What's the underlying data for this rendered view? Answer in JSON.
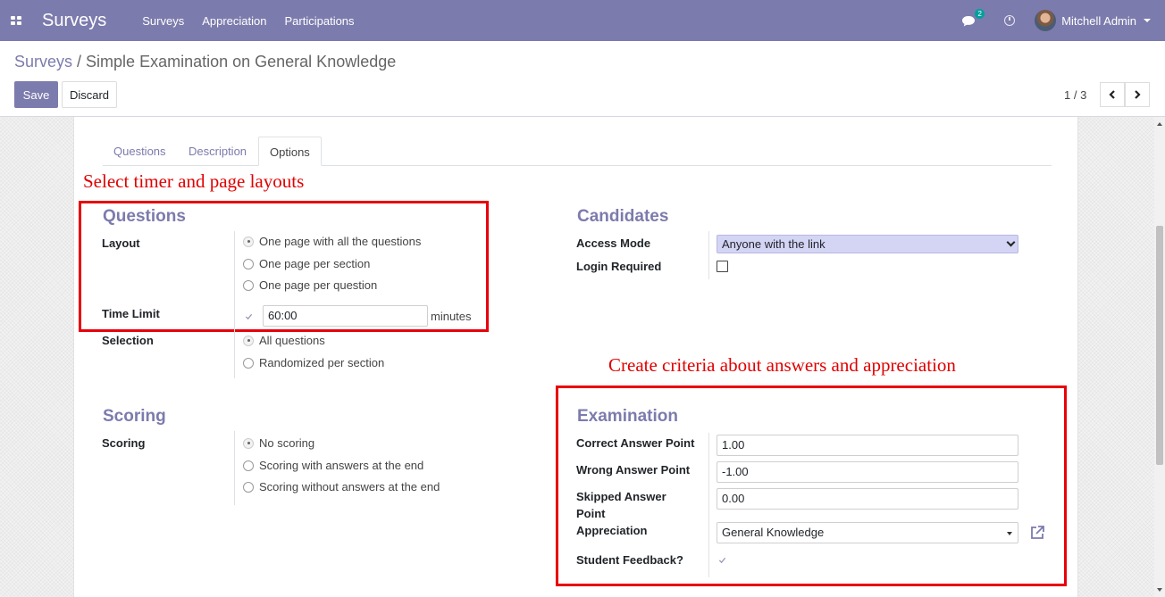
{
  "navbar": {
    "brand": "Surveys",
    "menu": [
      "Surveys",
      "Appreciation",
      "Participations"
    ],
    "chat_count": "2",
    "user": "Mitchell Admin",
    "bg_color": "#7c7bad"
  },
  "breadcrumb": {
    "parent": "Surveys",
    "separator": " / ",
    "current": "Simple Examination on General Knowledge"
  },
  "actions": {
    "save": "Save",
    "discard": "Discard"
  },
  "pager": {
    "value": "1 / 3"
  },
  "tabs": [
    "Questions",
    "Description",
    "Options"
  ],
  "annotations": {
    "layouts": "Select timer and page layouts",
    "criteria": "Create criteria about answers and appreciation"
  },
  "questions_group": {
    "title": "Questions",
    "layout_label": "Layout",
    "layout_options": [
      "One page with all the questions",
      "One page per section",
      "One page per question"
    ],
    "time_limit_label": "Time Limit",
    "time_limit_value": "60:00",
    "time_unit": "minutes",
    "selection_label": "Selection",
    "selection_options": [
      "All questions",
      "Randomized per section"
    ]
  },
  "candidates_group": {
    "title": "Candidates",
    "access_mode_label": "Access Mode",
    "access_mode_value": "Anyone with the link",
    "login_required_label": "Login Required"
  },
  "scoring_group": {
    "title": "Scoring",
    "scoring_label": "Scoring",
    "scoring_options": [
      "No scoring",
      "Scoring with answers at the end",
      "Scoring without answers at the end"
    ]
  },
  "examination_group": {
    "title": "Examination",
    "correct_label": "Correct Answer Point",
    "correct_value": "1.00",
    "wrong_label": "Wrong Answer Point",
    "wrong_value": "-1.00",
    "skipped_label_1": "Skipped Answer",
    "skipped_label_2": "Point",
    "skipped_value": "0.00",
    "appreciation_label": "Appreciation",
    "appreciation_value": "General Knowledge",
    "feedback_label": "Student Feedback?"
  }
}
